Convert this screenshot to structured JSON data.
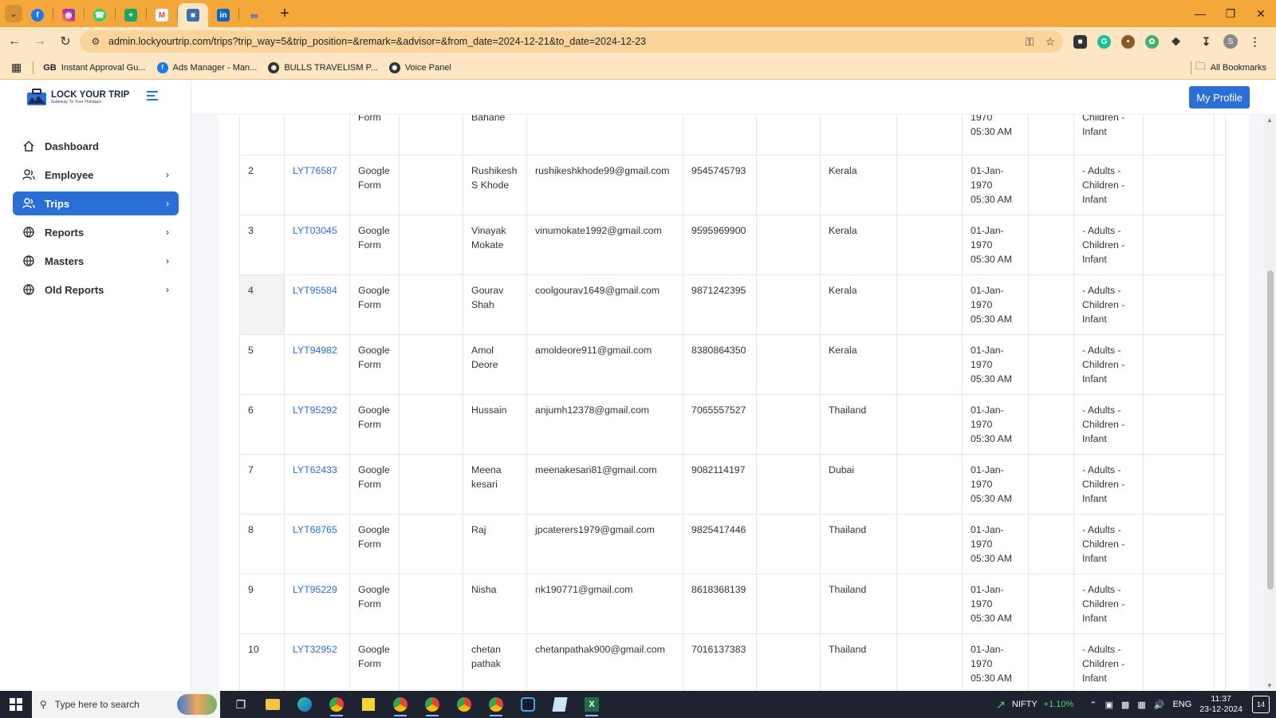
{
  "browser": {
    "url": "admin.lockyourtrip.com/trips?trip_way=5&trip_position=&remark=&advisor=&from_date=2024-12-21&to_date=2024-12-23",
    "bookmarks": [
      {
        "label": "Instant Approval Gu...",
        "icon": "gb-icon"
      },
      {
        "label": "Ads Manager - Man...",
        "icon": "facebook-icon"
      },
      {
        "label": "BULLS TRAVELISM P...",
        "icon": "globe-icon"
      },
      {
        "label": "Voice Panel",
        "icon": "globe-icon"
      }
    ],
    "all_bookmarks": "All Bookmarks",
    "gb_label": "GB",
    "profile_initial": "S"
  },
  "sidebar": {
    "logo_title": "LOCK YOUR TRIP",
    "logo_subtitle": "Gateway To Your Holidays",
    "items": [
      {
        "label": "Dashboard",
        "icon": "home-icon"
      },
      {
        "label": "Employee",
        "icon": "users-icon"
      },
      {
        "label": "Trips",
        "icon": "users-icon"
      },
      {
        "label": "Reports",
        "icon": "globe-icon"
      },
      {
        "label": "Masters",
        "icon": "globe-icon"
      },
      {
        "label": "Old Reports",
        "icon": "globe-icon"
      }
    ]
  },
  "header": {
    "profile_button": "My Profile"
  },
  "table": {
    "partial_row": {
      "source": "Form",
      "name": "Bahane",
      "date_year": "1970",
      "date_time": "05:30 AM",
      "pax_1": "Children -",
      "pax_2": "Infant"
    },
    "rows": [
      {
        "no": "2",
        "code": "LYT76587",
        "source_1": "Google",
        "source_2": "Form",
        "name_1": "Rushikesh",
        "name_2": "S Khode",
        "email": "rushikeshkhode99@gmail.com",
        "phone": "9545745793",
        "destination": "Kerala",
        "date_1": "01-Jan-",
        "date_2": "1970",
        "date_3": "05:30 AM",
        "pax_1": "- Adults -",
        "pax_2": "Children -",
        "pax_3": "Infant"
      },
      {
        "no": "3",
        "code": "LYT03045",
        "source_1": "Google",
        "source_2": "Form",
        "name_1": "Vinayak",
        "name_2": "Mokate",
        "email": "vinumokate1992@gmail.com",
        "phone": "9595969900",
        "destination": "Kerala",
        "date_1": "01-Jan-",
        "date_2": "1970",
        "date_3": "05:30 AM",
        "pax_1": "- Adults -",
        "pax_2": "Children -",
        "pax_3": "Infant"
      },
      {
        "no": "4",
        "code": "LYT95584",
        "source_1": "Google",
        "source_2": "Form",
        "name_1": "Gourav",
        "name_2": "Shah",
        "email": "coolgourav1649@gmail.com",
        "phone": "9871242395",
        "destination": "Kerala",
        "date_1": "01-Jan-",
        "date_2": "1970",
        "date_3": "05:30 AM",
        "pax_1": "- Adults -",
        "pax_2": "Children -",
        "pax_3": "Infant"
      },
      {
        "no": "5",
        "code": "LYT94982",
        "source_1": "Google",
        "source_2": "Form",
        "name_1": "Amol",
        "name_2": "Deore",
        "email": "amoldeore911@gmail.com",
        "phone": "8380864350",
        "destination": "Kerala",
        "date_1": "01-Jan-",
        "date_2": "1970",
        "date_3": "05:30 AM",
        "pax_1": "- Adults -",
        "pax_2": "Children -",
        "pax_3": "Infant"
      },
      {
        "no": "6",
        "code": "LYT95292",
        "source_1": "Google",
        "source_2": "Form",
        "name_1": "Hussain",
        "name_2": "",
        "email": "anjumh12378@gmail.com",
        "phone": "7065557527",
        "destination": "Thailand",
        "date_1": "01-Jan-",
        "date_2": "1970",
        "date_3": "05:30 AM",
        "pax_1": "- Adults -",
        "pax_2": "Children -",
        "pax_3": "Infant"
      },
      {
        "no": "7",
        "code": "LYT62433",
        "source_1": "Google",
        "source_2": "Form",
        "name_1": "Meena",
        "name_2": "kesari",
        "email": "meenakesari81@gmail.com",
        "phone": "9082114197",
        "destination": "Dubai",
        "date_1": "01-Jan-",
        "date_2": "1970",
        "date_3": "05:30 AM",
        "pax_1": "- Adults -",
        "pax_2": "Children -",
        "pax_3": "Infant"
      },
      {
        "no": "8",
        "code": "LYT68765",
        "source_1": "Google",
        "source_2": "Form",
        "name_1": "Raj",
        "name_2": "",
        "email": "jpcaterers1979@gmail.com",
        "phone": "9825417446",
        "destination": "Thailand",
        "date_1": "01-Jan-",
        "date_2": "1970",
        "date_3": "05:30 AM",
        "pax_1": "- Adults -",
        "pax_2": "Children -",
        "pax_3": "Infant"
      },
      {
        "no": "9",
        "code": "LYT95229",
        "source_1": "Google",
        "source_2": "Form",
        "name_1": "Nisha",
        "name_2": "",
        "email": "nk190771@gmail.com",
        "phone": "8618368139",
        "destination": "Thailand",
        "date_1": "01-Jan-",
        "date_2": "1970",
        "date_3": "05:30 AM",
        "pax_1": "- Adults -",
        "pax_2": "Children -",
        "pax_3": "Infant"
      },
      {
        "no": "10",
        "code": "LYT32952",
        "source_1": "Google",
        "source_2": "Form",
        "name_1": "chetan",
        "name_2": "pathak",
        "email": "chetanpathak900@gmail.com",
        "phone": "7016137383",
        "destination": "Thailand",
        "date_1": "01-Jan-",
        "date_2": "1970",
        "date_3": "05:30 AM",
        "pax_1": "- Adults -",
        "pax_2": "Children -",
        "pax_3": "Infant"
      }
    ]
  },
  "taskbar": {
    "search_placeholder": "Type here to search",
    "nifty_label": "NIFTY",
    "nifty_change": "+1.10%",
    "language": "ENG",
    "time": "11:37",
    "date": "23-12-2024",
    "notifications": "14"
  },
  "colors": {
    "accent": "#2b6fd6",
    "tabbar": "#f5a83a",
    "toolbar": "#fde6c3"
  }
}
